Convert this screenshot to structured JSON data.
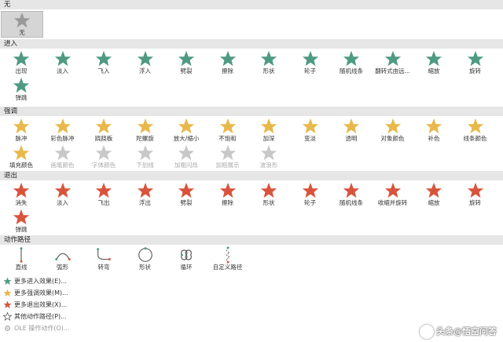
{
  "sections": {
    "none": "无",
    "entrance": "进入",
    "emphasis": "强调",
    "exit": "退出",
    "motion": "动作路径"
  },
  "none_items": [
    "无"
  ],
  "entrance_items": [
    "出现",
    "淡入",
    "飞入",
    "浮入",
    "劈裂",
    "擦除",
    "形状",
    "轮子",
    "随机线条",
    "翻转式由远...",
    "缩放",
    "旋转",
    "弹跳"
  ],
  "emphasis_items": [
    "脉冲",
    "彩色脉冲",
    "跷跷板",
    "陀螺旋",
    "放大/缩小",
    "不饱和",
    "加深",
    "变淡",
    "透明",
    "对象颜色",
    "补色",
    "线条颜色",
    "填充颜色",
    "画笔颜色",
    "字体颜色",
    "下划线",
    "加粗闪烁",
    "加粗展示",
    "波浪形"
  ],
  "exit_items": [
    "消失",
    "淡入",
    "飞出",
    "浮出",
    "劈裂",
    "擦除",
    "形状",
    "轮子",
    "随机线条",
    "收缩并旋转",
    "缩放",
    "旋转",
    "弹跳"
  ],
  "motion_items": [
    "直线",
    "弧形",
    "转弯",
    "形状",
    "循环",
    "自定义路径"
  ],
  "menu": [
    "更多进入效果(E)...",
    "更多强调效果(M)...",
    "更多退出效果(X)...",
    "其他动作路径(P)...",
    "OLE 操作动作(O)..."
  ],
  "colors": {
    "entrance": "#4e9a83",
    "emphasis": "#e8b84a",
    "exit": "#d9533c",
    "none": "#9a9a9a",
    "disabled": "#c8c8c8"
  },
  "watermark": "头条@悟空问答"
}
